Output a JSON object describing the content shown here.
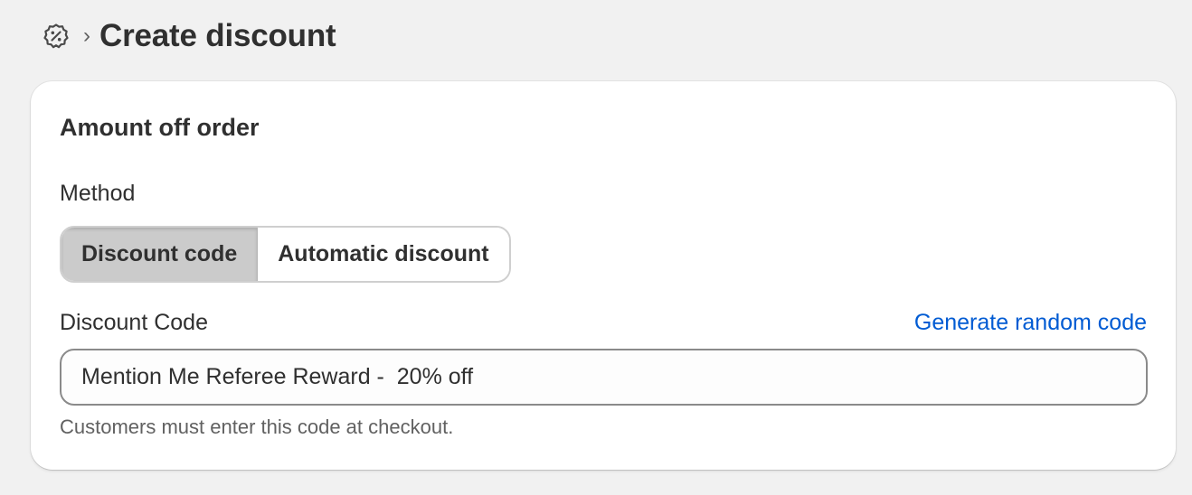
{
  "header": {
    "icon": "discount-badge-icon",
    "separator": "›",
    "title": "Create discount"
  },
  "card": {
    "title": "Amount off order",
    "method": {
      "label": "Method",
      "options": [
        {
          "label": "Discount code",
          "selected": true
        },
        {
          "label": "Automatic discount",
          "selected": false
        }
      ]
    },
    "code": {
      "label": "Discount Code",
      "generate_link": "Generate random code",
      "value": "Mention Me Referee Reward -  20% off",
      "help_text": "Customers must enter this code at checkout."
    }
  },
  "colors": {
    "background": "#f1f1f1",
    "card": "#ffffff",
    "link": "#005bd3",
    "selected_segment": "#cbcbcb"
  }
}
